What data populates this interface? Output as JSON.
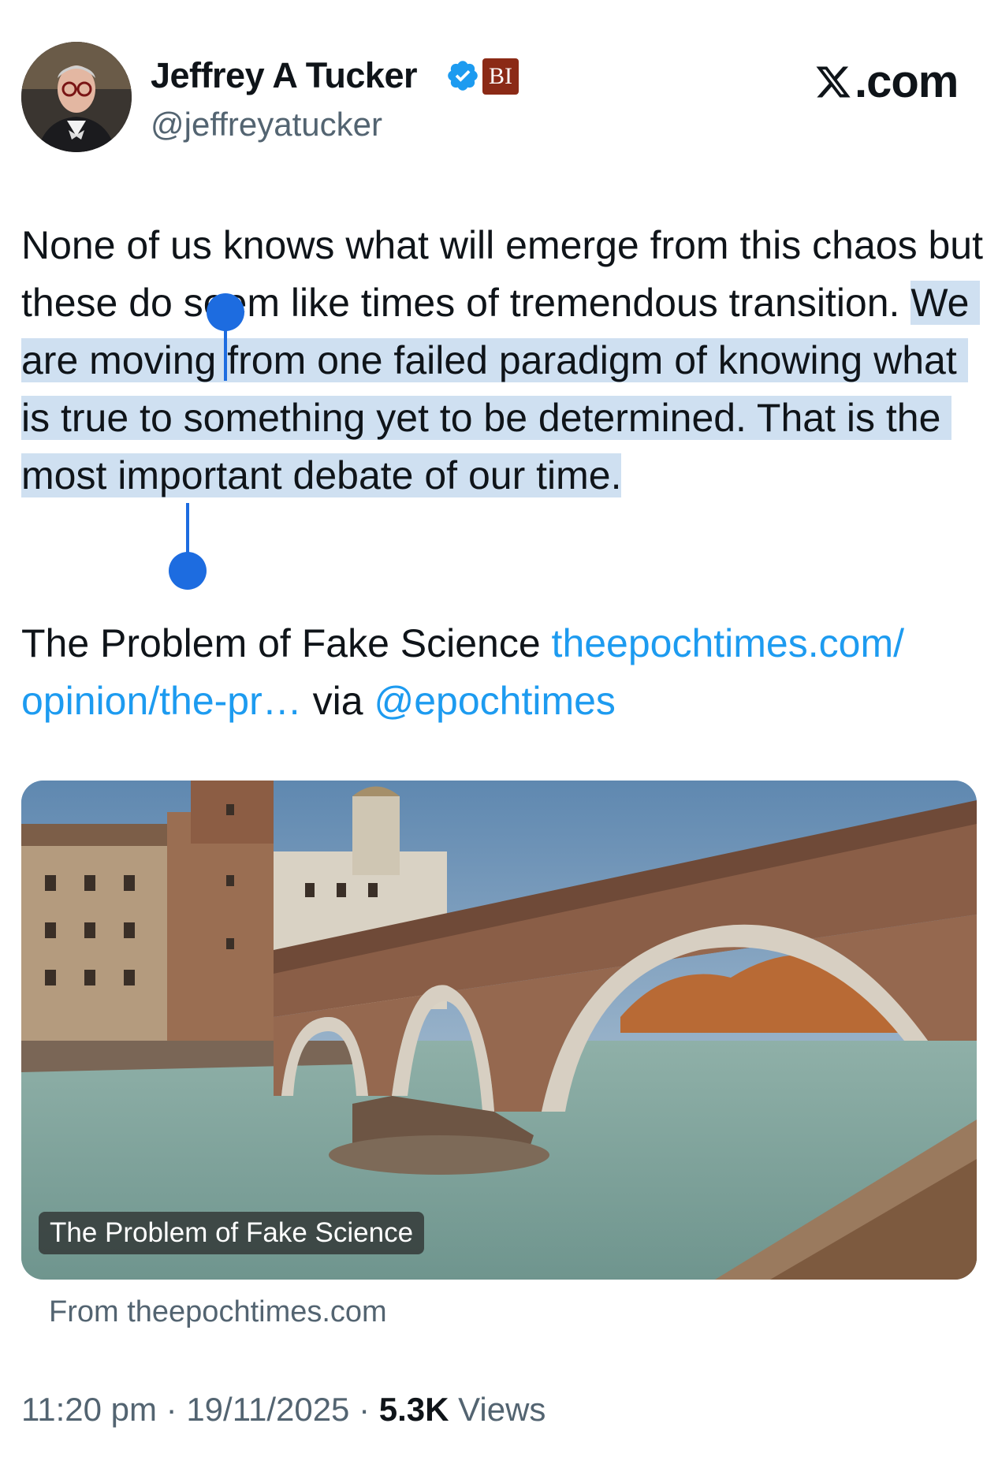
{
  "author": {
    "display_name": "Jeffrey A Tucker",
    "handle": "@jeffreyatucker",
    "affiliation_badge": "BI",
    "verified": true
  },
  "brand": {
    "logo_icon": "x-logo-icon",
    "site_suffix": ".com"
  },
  "tweet": {
    "text_before_selection": "None of us knows what will emerge from this chaos but these do seem like times of tremendous transition. ",
    "text_selected": "We are moving from one failed paradigm of knowing what is true to something yet to be determined. That is the most important debate of our time.",
    "link_prefix": "The Problem of Fake Science ",
    "link_url": "theepochtimes.com/ opinion/the-pr…",
    "via_text": " via ",
    "mention": "@epochtimes"
  },
  "card": {
    "title": "The Problem of Fake Science",
    "source": "From theepochtimes.com",
    "image_description_icon": "bridge-photo"
  },
  "meta": {
    "time": "11:20 pm",
    "date": "19/11/2025",
    "separator": " · ",
    "views_count": "5.3K",
    "views_label": " Views"
  },
  "colors": {
    "link": "#1d9bf0",
    "secondary_text": "#536471",
    "selection": "#cfe0f1",
    "selection_handle": "#1d6ce0",
    "verified": "#1d9bf0",
    "affiliation_badge": "#8b2a16"
  }
}
